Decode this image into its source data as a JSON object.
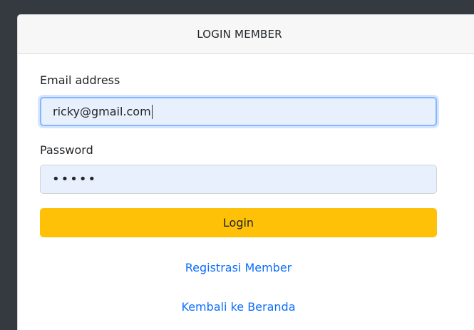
{
  "card": {
    "title": "LOGIN MEMBER"
  },
  "form": {
    "email_label": "Email address",
    "email_value": "ricky@gmail.com",
    "password_label": "Password",
    "password_value": "•••••",
    "login_label": "Login"
  },
  "links": {
    "register": "Registrasi Member",
    "home": "Kembali ke Beranda"
  },
  "colors": {
    "background": "#343a40",
    "button": "#ffc107",
    "link": "#0d6efd",
    "input_autofill": "#e8f0fe"
  }
}
